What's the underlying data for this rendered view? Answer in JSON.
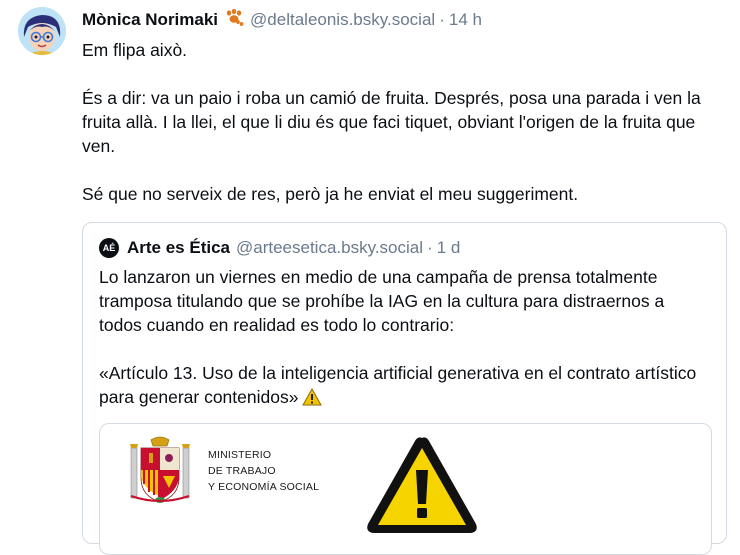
{
  "post": {
    "author_name": "Mònica Norimaki",
    "author_emoji": "🐾",
    "handle": "@deltaleonis.bsky.social",
    "separator": "·",
    "time": "14 h",
    "paragraphs": [
      "Em flipa això.",
      "És a dir: va un paio i roba un camió de fruita. Després, posa una parada i ven la fruita allà. I la llei, el que li diu és que faci tiquet, obviant l'origen de la fruita que ven.",
      "Sé que no serveix de res, però ja he enviat el meu suggeriment."
    ]
  },
  "quote": {
    "avatar_text": "AÉ",
    "author_name": "Arte es Ética",
    "handle": "@arteesetica.bsky.social",
    "separator": "·",
    "time": "1 d",
    "paragraphs": [
      "Lo lanzaron un viernes en medio de una campaña de prensa totalmente tramposa titulando que se prohíbe la IAG en la cultura para distraernos a todos cuando en realidad es todo lo contrario:",
      "«Artículo 13. Uso de la inteligencia artificial generativa en el contrato artístico para generar contenidos»"
    ],
    "image": {
      "ministry_lines": [
        "MINISTERIO",
        "DE TRABAJO",
        "Y ECONOMÍA SOCIAL"
      ]
    }
  },
  "colors": {
    "text": "#0b0f14",
    "muted": "#6b7a8c",
    "border": "#d4dbe2",
    "warning_yellow": "#f5d400"
  }
}
